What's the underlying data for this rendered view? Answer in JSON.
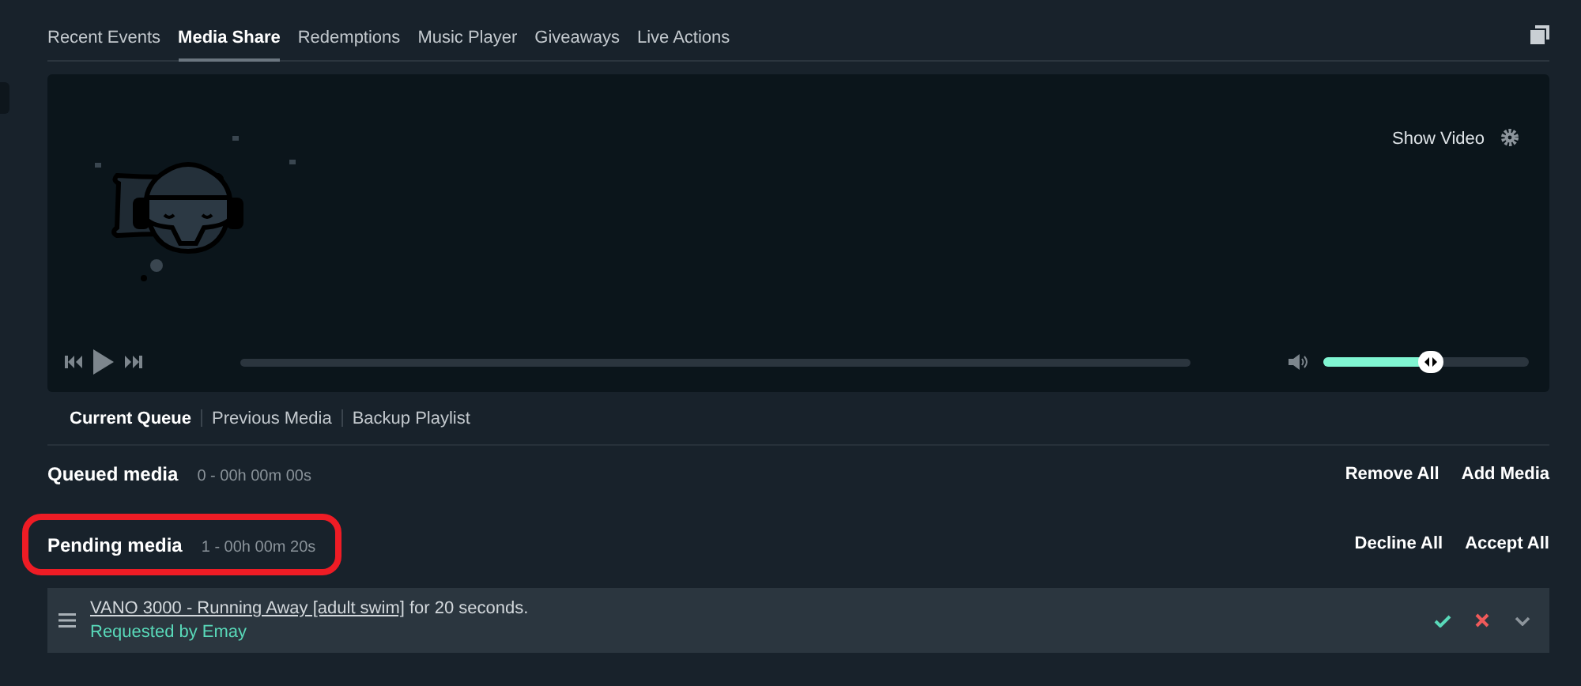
{
  "tabs": [
    {
      "label": "Recent Events",
      "selected": false
    },
    {
      "label": "Media Share",
      "selected": true
    },
    {
      "label": "Redemptions",
      "selected": false
    },
    {
      "label": "Music Player",
      "selected": false
    },
    {
      "label": "Giveaways",
      "selected": false
    },
    {
      "label": "Live Actions",
      "selected": false
    }
  ],
  "player": {
    "show_video": "Show Video",
    "volume": {
      "level": 0.52
    }
  },
  "queue_tabs": [
    {
      "label": "Current Queue",
      "selected": true
    },
    {
      "label": "Previous Media",
      "selected": false
    },
    {
      "label": "Backup Playlist",
      "selected": false
    }
  ],
  "sections": [
    {
      "title": "Queued media",
      "summary": "0 - 00h 00m 00s",
      "highlighted": false,
      "buttons": [
        "Remove All",
        "Add Media"
      ]
    },
    {
      "title": "Pending media",
      "summary": "1 - 00h 00m 20s",
      "highlighted": true,
      "buttons": [
        "Decline All",
        "Accept All"
      ],
      "items": [
        {
          "title": "VANO 3000 - Running Away [adult swim]",
          "duration": "for 20 seconds.",
          "requested_by": "Requested by Emay"
        }
      ]
    }
  ]
}
